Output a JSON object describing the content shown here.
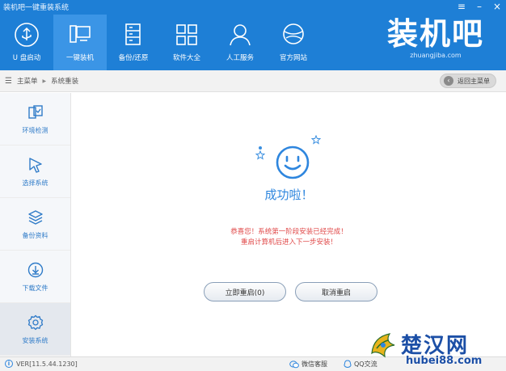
{
  "window": {
    "title": "装机吧一键重装系统",
    "controls": [
      "≡",
      "–",
      "×"
    ]
  },
  "nav": {
    "items": [
      {
        "label": "U 盘启动",
        "icon": "usb-icon"
      },
      {
        "label": "一键装机",
        "icon": "monitor-icon",
        "active": true
      },
      {
        "label": "备份/还原",
        "icon": "backup-icon"
      },
      {
        "label": "软件大全",
        "icon": "apps-grid-icon"
      },
      {
        "label": "人工服务",
        "icon": "user-service-icon"
      },
      {
        "label": "官方网站",
        "icon": "globe-icon"
      }
    ]
  },
  "brand": {
    "logo": "装机吧",
    "url": "zhuangjiba.com"
  },
  "breadcrumb": {
    "home": "主菜单",
    "separator": "▶",
    "current": "系统重装"
  },
  "back_button": {
    "label": "返回主菜单"
  },
  "sidebar": {
    "items": [
      {
        "label": "环境检测",
        "icon": "environment-check-icon"
      },
      {
        "label": "选择系统",
        "icon": "cursor-icon"
      },
      {
        "label": "备份资料",
        "icon": "layers-icon"
      },
      {
        "label": "下载文件",
        "icon": "download-icon"
      },
      {
        "label": "安装系统",
        "icon": "gear-icon",
        "active": true
      }
    ]
  },
  "main": {
    "title": "成功啦！",
    "message_line1": "恭喜您！系统第一阶段安装已经完成！",
    "message_line2": "重启计算机后进入下一步安装！",
    "restart_label": "立即重启(0)",
    "cancel_label": "取消重启"
  },
  "status": {
    "version": "VER[11.5.44.1230]",
    "wechat": "微信客服",
    "qq": "QQ交流"
  },
  "watermark": {
    "text": "楚汉网",
    "url": "hubei88.com"
  },
  "colors": {
    "header": "#1e7fd6",
    "active_nav": "#3b95e6",
    "accent": "#2e86de",
    "message": "#e04848"
  }
}
